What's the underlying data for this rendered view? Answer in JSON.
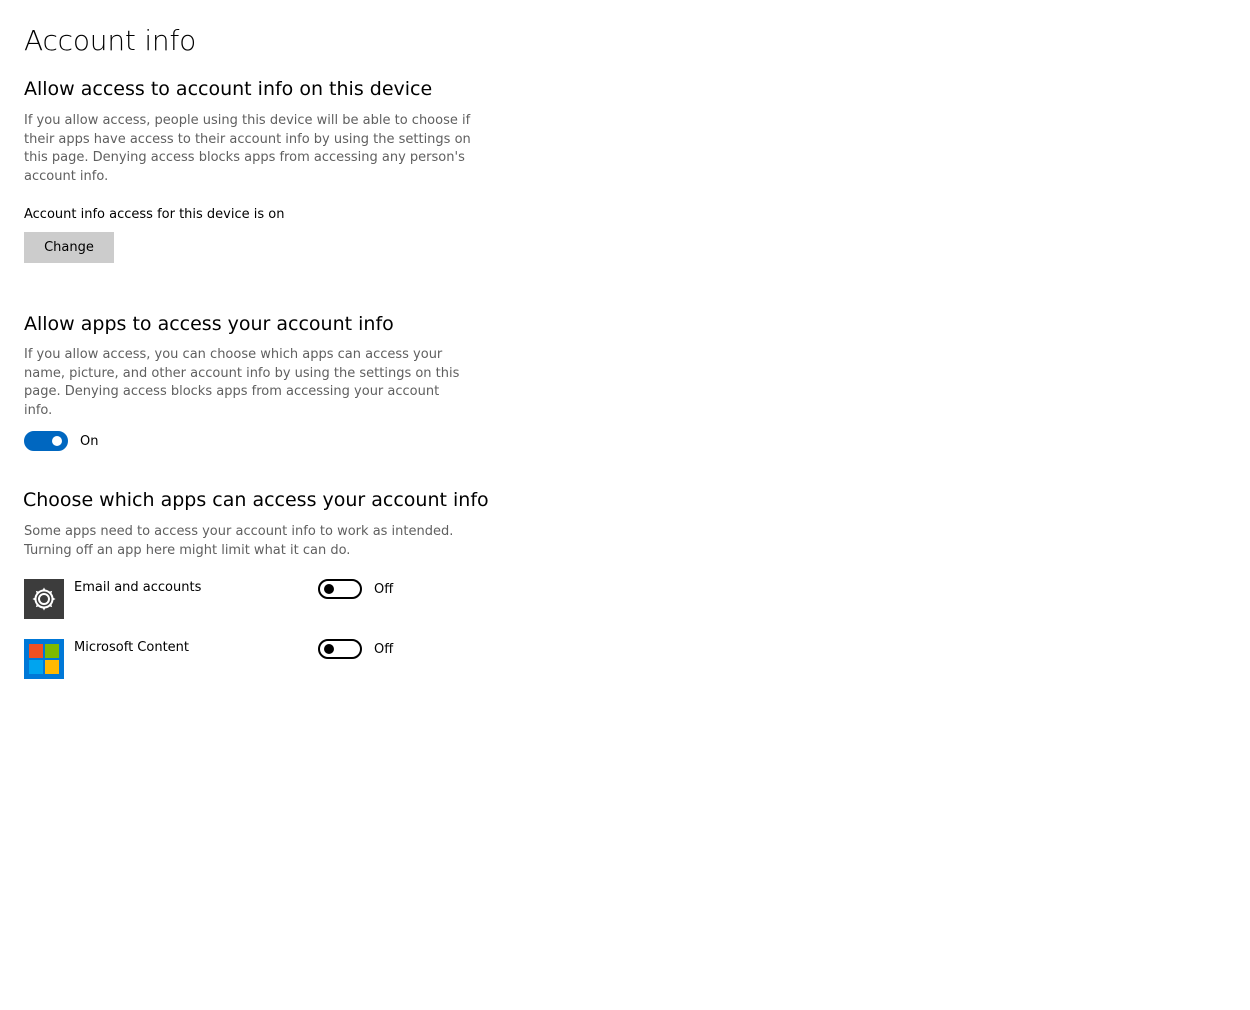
{
  "page": {
    "title": "Account info"
  },
  "device_access": {
    "heading": "Allow access to account info on this device",
    "description": "If you allow access, people using this device will be able to choose if their apps have access to their account info by using the settings on this page. Denying access blocks apps from accessing any person's account info.",
    "status": "Account info access for this device is on",
    "change_label": "Change"
  },
  "apps_access": {
    "heading": "Allow apps to access your account info",
    "description": "If you allow access, you can choose which apps can access your name, picture, and other account info by using the settings on this page. Denying access blocks apps from accessing your account info.",
    "toggle_state": "On",
    "toggle_on": true
  },
  "choose_apps": {
    "heading": "Choose which apps can access your account info",
    "description": "Some apps need to access your account info to work as intended. Turning off an app here might limit what it can do.",
    "apps": [
      {
        "name": "Email and accounts",
        "icon": "gear-icon",
        "state": "Off",
        "on": false
      },
      {
        "name": "Microsoft Content",
        "icon": "microsoft-logo-icon",
        "state": "Off",
        "on": false
      }
    ]
  },
  "colors": {
    "accent": "#0067c0",
    "button_bg": "#cccccc",
    "description_text": "#5f5f5f",
    "settings_icon_bg": "#3c3c3c",
    "ms_icon_bg": "#0078d7"
  }
}
